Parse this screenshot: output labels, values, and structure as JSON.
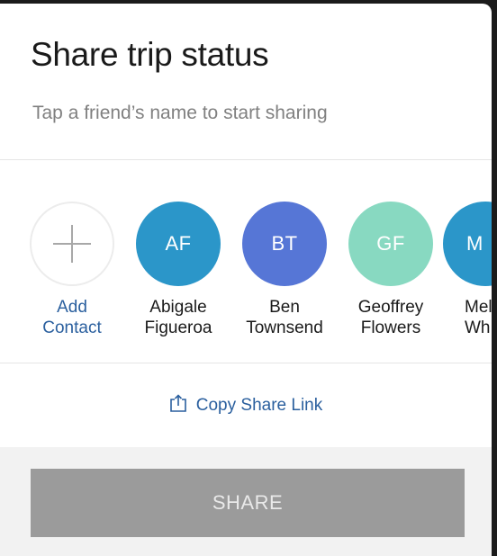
{
  "sheet": {
    "title": "Share trip status",
    "subtitle": "Tap a friend’s name to start sharing"
  },
  "contacts": [
    {
      "initials": "",
      "first": "Add",
      "last": "Contact",
      "color": "#ffffff",
      "icon": "plus-icon",
      "is_add": true
    },
    {
      "initials": "AF",
      "first": "Abigale",
      "last": "Figueroa",
      "color": "#2b96c9"
    },
    {
      "initials": "BT",
      "first": "Ben",
      "last": "Townsend",
      "color": "#5676d6"
    },
    {
      "initials": "GF",
      "first": "Geoffrey",
      "last": "Flowers",
      "color": "#88d9c1"
    },
    {
      "initials": "M",
      "first": "Mel",
      "last": "Wh",
      "color": "#2b96c9"
    }
  ],
  "copy_link": {
    "label": "Copy Share Link",
    "icon": "share-upload-icon",
    "color": "#2a5f9e"
  },
  "share_button": {
    "label": "SHARE",
    "color": "#9b9b9b"
  }
}
